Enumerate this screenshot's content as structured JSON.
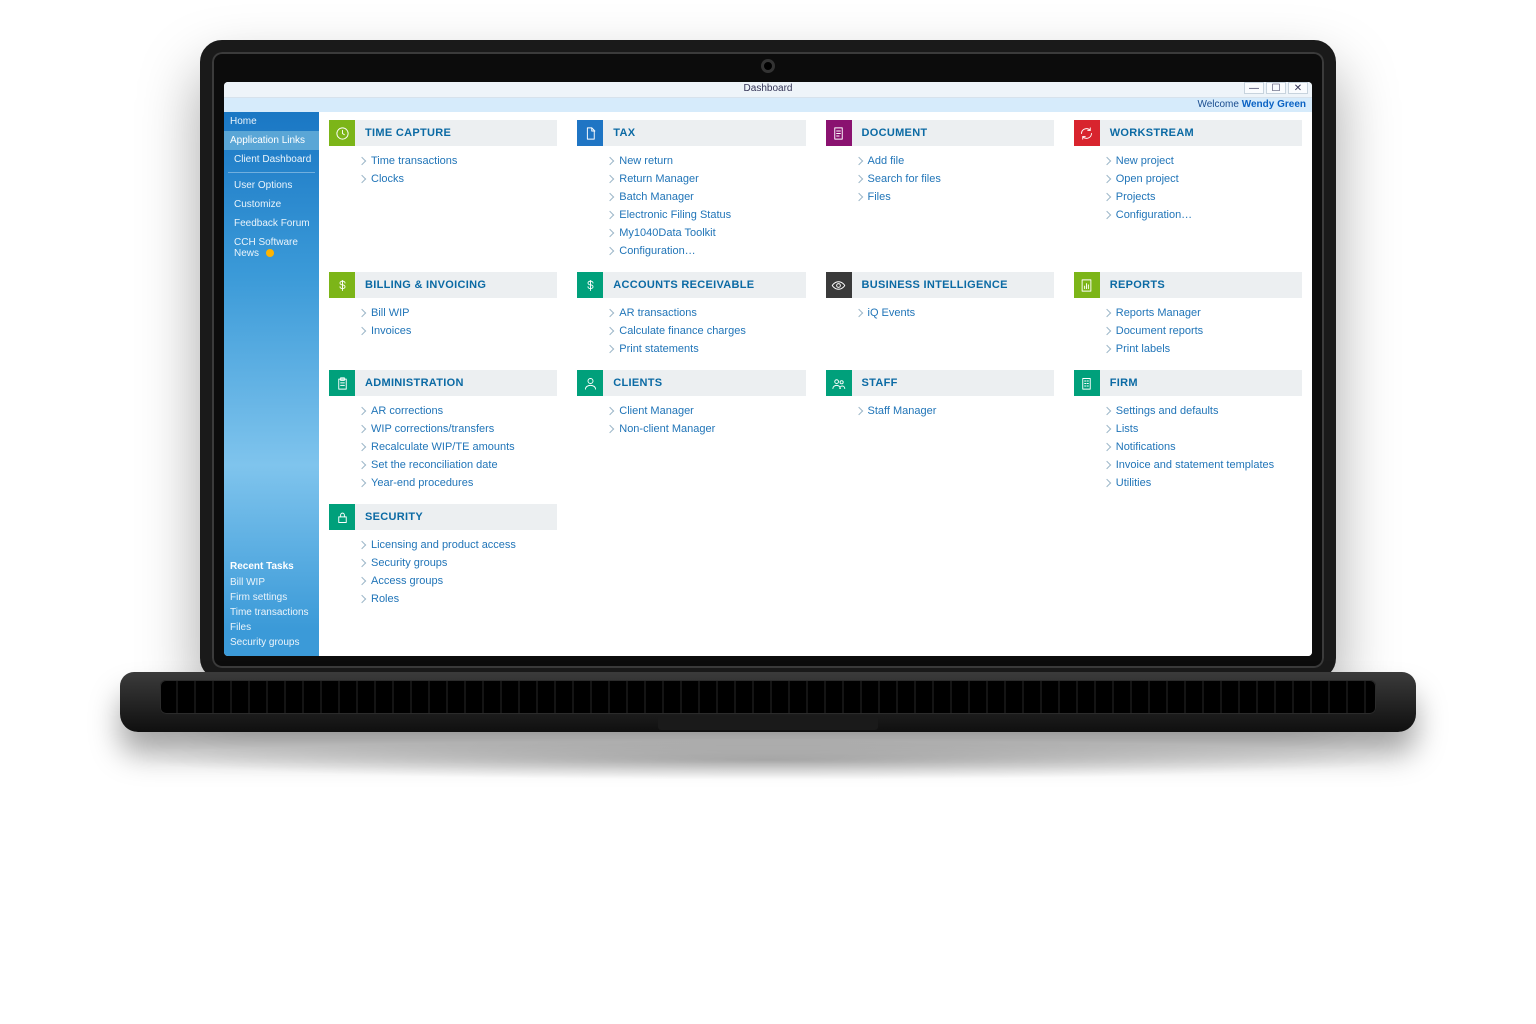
{
  "window": {
    "title": "Dashboard",
    "minimize": "—",
    "maximize": "☐",
    "close": "✕"
  },
  "welcome": {
    "prefix": "Welcome ",
    "user": "Wendy Green"
  },
  "sidebar": {
    "items": [
      {
        "label": "Home"
      },
      {
        "label": "Application Links"
      },
      {
        "label": "Client Dashboard"
      },
      {
        "label": "User Options"
      },
      {
        "label": "Customize"
      },
      {
        "label": "Feedback Forum"
      },
      {
        "label": "CCH Software News",
        "badge": true
      }
    ],
    "recent_title": "Recent Tasks",
    "recent": [
      {
        "label": "Bill WIP"
      },
      {
        "label": "Firm settings"
      },
      {
        "label": "Time transactions"
      },
      {
        "label": "Files"
      },
      {
        "label": "Security groups"
      }
    ]
  },
  "tiles": [
    {
      "id": "time-capture",
      "title": "TIME CAPTURE",
      "color": "c-green",
      "icon": "clock",
      "links": [
        "Time transactions",
        "Clocks"
      ]
    },
    {
      "id": "tax",
      "title": "TAX",
      "color": "c-blue",
      "icon": "file",
      "links": [
        "New return",
        "Return Manager",
        "Batch Manager",
        "Electronic Filing Status",
        "My1040Data Toolkit",
        "Configuration…"
      ]
    },
    {
      "id": "document",
      "title": "DOCUMENT",
      "color": "c-magenta",
      "icon": "doc",
      "links": [
        "Add file",
        "Search for files",
        "Files"
      ]
    },
    {
      "id": "workstream",
      "title": "WORKSTREAM",
      "color": "c-red",
      "icon": "cycle",
      "links": [
        "New project",
        "Open project",
        "Projects",
        "Configuration…"
      ]
    },
    {
      "id": "billing",
      "title": "BILLING & INVOICING",
      "color": "c-green",
      "icon": "dollar",
      "links": [
        "Bill WIP",
        "Invoices"
      ]
    },
    {
      "id": "ar",
      "title": "ACCOUNTS RECEIVABLE",
      "color": "c-teal",
      "icon": "dollar",
      "links": [
        "AR transactions",
        "Calculate finance charges",
        "Print statements"
      ]
    },
    {
      "id": "bi",
      "title": "BUSINESS INTELLIGENCE",
      "color": "c-dark",
      "icon": "eye",
      "links": [
        "iQ Events"
      ]
    },
    {
      "id": "reports",
      "title": "REPORTS",
      "color": "c-green",
      "icon": "report",
      "links": [
        "Reports Manager",
        "Document reports",
        "Print labels"
      ]
    },
    {
      "id": "admin",
      "title": "ADMINISTRATION",
      "color": "c-teal",
      "icon": "clipboard",
      "links": [
        "AR corrections",
        "WIP corrections/transfers",
        "Recalculate WIP/TE amounts",
        "Set the reconciliation date",
        "Year-end procedures"
      ]
    },
    {
      "id": "clients",
      "title": "CLIENTS",
      "color": "c-teal",
      "icon": "person",
      "links": [
        "Client Manager",
        "Non-client Manager"
      ]
    },
    {
      "id": "staff",
      "title": "STAFF",
      "color": "c-teal",
      "icon": "people",
      "links": [
        "Staff Manager"
      ]
    },
    {
      "id": "firm",
      "title": "FIRM",
      "color": "c-teal",
      "icon": "building",
      "links": [
        "Settings and defaults",
        "Lists",
        "Notifications",
        "Invoice and statement templates",
        "Utilities"
      ]
    },
    {
      "id": "security",
      "title": "SECURITY",
      "color": "c-teal",
      "icon": "lock",
      "links": [
        "Licensing and product access",
        "Security groups",
        "Access groups",
        "Roles"
      ]
    }
  ]
}
